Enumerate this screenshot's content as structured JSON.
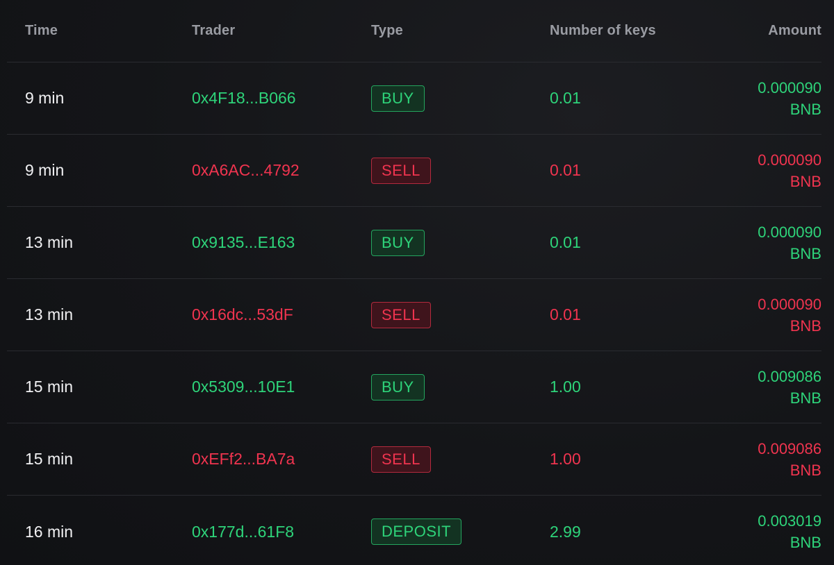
{
  "header": {
    "time": "Time",
    "trader": "Trader",
    "type": "Type",
    "keys": "Number of keys",
    "amount": "Amount"
  },
  "rows": [
    {
      "time": "9 min",
      "trader": "0x4F18...B066",
      "type": "BUY",
      "keys": "0.01",
      "amount": "0.000090",
      "currency": "BNB",
      "color": "#2ed47a"
    },
    {
      "time": "9 min",
      "trader": "0xA6AC...4792",
      "type": "SELL",
      "keys": "0.01",
      "amount": "0.000090",
      "currency": "BNB",
      "color": "#f0344f"
    },
    {
      "time": "13 min",
      "trader": "0x9135...E163",
      "type": "BUY",
      "keys": "0.01",
      "amount": "0.000090",
      "currency": "BNB",
      "color": "#2ed47a"
    },
    {
      "time": "13 min",
      "trader": "0x16dc...53dF",
      "type": "SELL",
      "keys": "0.01",
      "amount": "0.000090",
      "currency": "BNB",
      "color": "#f0344f"
    },
    {
      "time": "15 min",
      "trader": "0x5309...10E1",
      "type": "BUY",
      "keys": "1.00",
      "amount": "0.009086",
      "currency": "BNB",
      "color": "#2ed47a"
    },
    {
      "time": "15 min",
      "trader": "0xEFf2...BA7a",
      "type": "SELL",
      "keys": "1.00",
      "amount": "0.009086",
      "currency": "BNB",
      "color": "#f0344f"
    },
    {
      "time": "16 min",
      "trader": "0x177d...61F8",
      "type": "DEPOSIT",
      "keys": "2.99",
      "amount": "0.003019",
      "currency": "BNB",
      "color": "#2ed47a"
    }
  ]
}
